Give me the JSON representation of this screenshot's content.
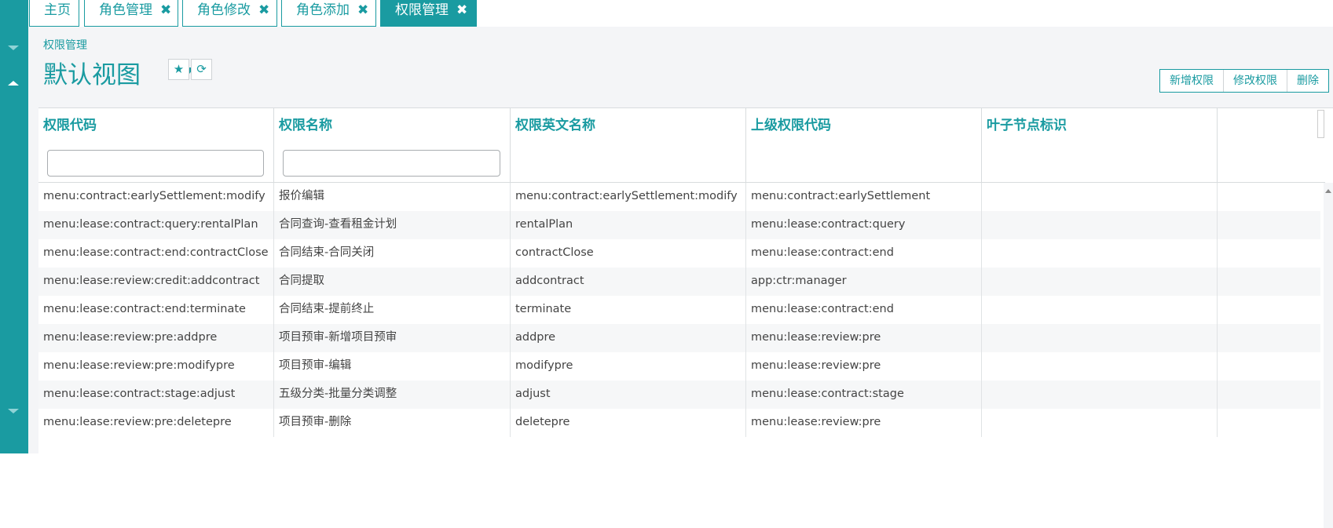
{
  "tabs": [
    {
      "label": "主页",
      "closable": false
    },
    {
      "label": "角色管理",
      "closable": true
    },
    {
      "label": "角色修改",
      "closable": true
    },
    {
      "label": "角色添加",
      "closable": true
    },
    {
      "label": "权限管理",
      "closable": true,
      "active": true
    }
  ],
  "close_glyph": "✖",
  "breadcrumb": "权限管理",
  "view_title": "默认视图",
  "icons": {
    "star": "★",
    "refresh": "⟳"
  },
  "actions": [
    "新增权限",
    "修改权限",
    "删除"
  ],
  "columns": [
    "权限代码",
    "权限名称",
    "权限英文名称",
    "上级权限代码",
    "叶子节点标识"
  ],
  "rows": [
    [
      "menu:contract:earlySettlement:modify",
      "报价编辑",
      "menu:contract:earlySettlement:modify",
      "menu:contract:earlySettlement",
      ""
    ],
    [
      "menu:lease:contract:query:rentalPlan",
      "合同查询-查看租金计划",
      "rentalPlan",
      "menu:lease:contract:query",
      ""
    ],
    [
      "menu:lease:contract:end:contractClose",
      "合同结束-合同关闭",
      "contractClose",
      "menu:lease:contract:end",
      ""
    ],
    [
      "menu:lease:review:credit:addcontract",
      "合同提取",
      "addcontract",
      "app:ctr:manager",
      ""
    ],
    [
      "menu:lease:contract:end:terminate",
      "合同结束-提前终止",
      "terminate",
      "menu:lease:contract:end",
      ""
    ],
    [
      "menu:lease:review:pre:addpre",
      "项目预审-新增项目预审",
      "addpre",
      "menu:lease:review:pre",
      ""
    ],
    [
      "menu:lease:review:pre:modifypre",
      "项目预审-编辑",
      "modifypre",
      "menu:lease:review:pre",
      ""
    ],
    [
      "menu:lease:contract:stage:adjust",
      "五级分类-批量分类调整",
      "adjust",
      "menu:lease:contract:stage",
      ""
    ],
    [
      "menu:lease:review:pre:deletepre",
      "项目预审-删除",
      "deletepre",
      "menu:lease:review:pre",
      ""
    ]
  ],
  "colors": {
    "accent": "#1a9ba1",
    "background": "#f4f5f7"
  }
}
